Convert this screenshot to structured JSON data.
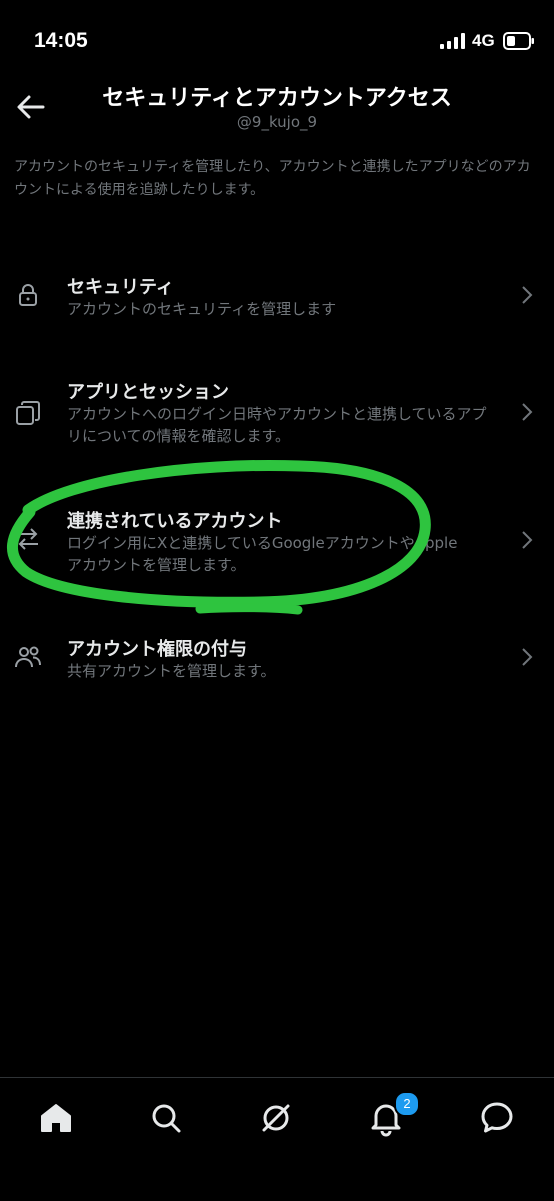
{
  "status_bar": {
    "time": "14:05",
    "network": "4G",
    "icons": [
      "signal-icon",
      "battery-icon"
    ]
  },
  "header": {
    "title": "セキュリティとアカウントアクセス",
    "handle": "@9_kujo_9"
  },
  "description": "アカウントのセキュリティを管理したり、アカウントと連携したアプリなどのアカウントによる使用を追跡したりします。",
  "items": [
    {
      "icon": "lock-icon",
      "title": "セキュリティ",
      "subtitle": "アカウントのセキュリティを管理します"
    },
    {
      "icon": "copy-windows-icon",
      "title": "アプリとセッション",
      "subtitle": "アカウントへのログイン日時やアカウントと連携しているアプリについての情報を確認します。"
    },
    {
      "icon": "arrows-exchange-icon",
      "title": "連携されているアカウント",
      "subtitle": "ログイン用にXと連携しているGoogleアカウントやAppleアカウントを管理します。"
    },
    {
      "icon": "people-icon",
      "title": "アカウント権限の付与",
      "subtitle": "共有アカウントを管理します。"
    }
  ],
  "bottom_nav": {
    "items": [
      "home-icon",
      "search-icon",
      "grok-icon",
      "bell-icon",
      "messages-icon"
    ],
    "notification_count": "2"
  },
  "colors": {
    "background": "#000000",
    "text_primary": "#e7e9ea",
    "text_secondary": "#71767b",
    "annotation_green": "#2ec43f",
    "badge_blue": "#1d9bf0"
  }
}
